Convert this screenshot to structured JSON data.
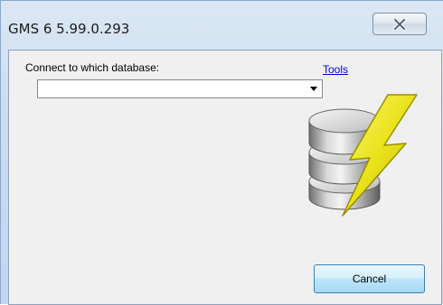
{
  "window": {
    "title": "GMS 6 5.99.0.293"
  },
  "form": {
    "connect_label": "Connect to which database:",
    "tools_link": "Tools",
    "database_value": ""
  },
  "buttons": {
    "cancel_label": "Cancel"
  },
  "icons": {
    "close": "close-icon",
    "database": "database-lightning-icon"
  },
  "colors": {
    "link": "#0000ee",
    "lightning": "#f2e92a"
  }
}
